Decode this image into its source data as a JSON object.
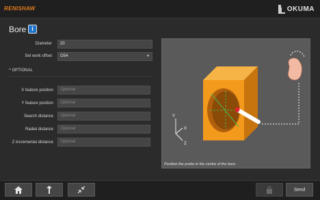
{
  "brand": {
    "left": "RENISHAW",
    "right": "OKUMA"
  },
  "page": {
    "title": "Bore"
  },
  "form": {
    "diameter": {
      "label": "Diameter",
      "value": "20"
    },
    "work_offset": {
      "label": "Set work offset",
      "value": "G54"
    },
    "optional_toggle": "^ OPTIONAL",
    "optional_fields": [
      {
        "label": "X feature position",
        "placeholder": "Optional"
      },
      {
        "label": "Y feature position",
        "placeholder": "Optional"
      },
      {
        "label": "Search distance",
        "placeholder": "Optional"
      },
      {
        "label": "Radial distance",
        "placeholder": "Optional"
      },
      {
        "label": "Z incremental distance",
        "placeholder": "Optional"
      }
    ]
  },
  "illustration": {
    "caption": "Position the probe in the centre of the bore.",
    "axes": {
      "y": "Y",
      "x": "X",
      "z": "Z"
    }
  },
  "footer": {
    "home_icon": "home-icon",
    "up_icon": "arrow-up-icon",
    "collapse_icon": "collapse-icon",
    "disabled_icon": "lock-icon",
    "send_label": "Send"
  },
  "colors": {
    "accent": "#e07a1a",
    "info": "#1e73c9",
    "block": "#f39a1c"
  }
}
